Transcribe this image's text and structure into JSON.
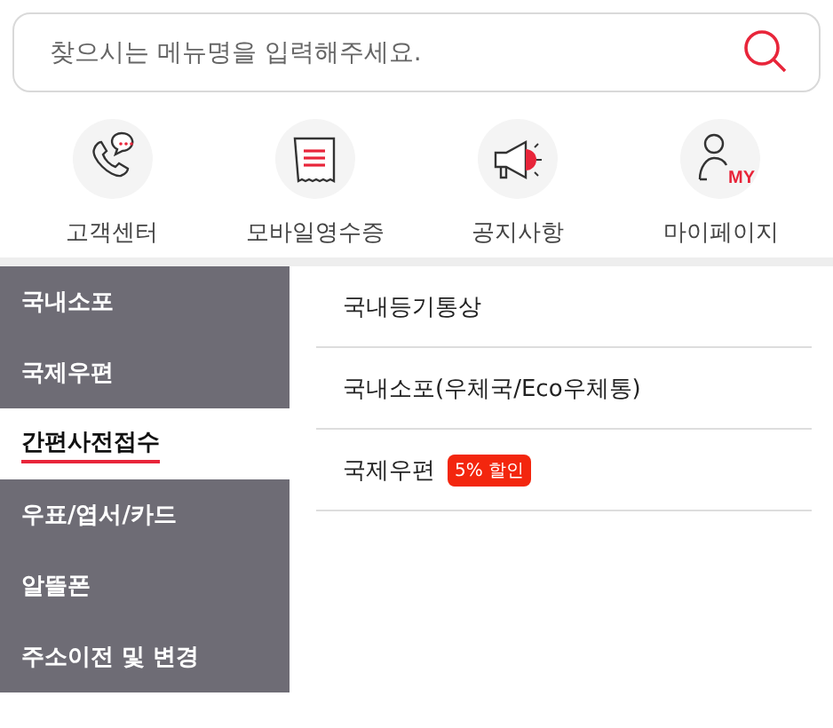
{
  "search": {
    "placeholder": "찾으시는 메뉴명을 입력해주세요."
  },
  "shortcuts": [
    {
      "label": "고객센터",
      "kind": "phone"
    },
    {
      "label": "모바일영수증",
      "kind": "receipt"
    },
    {
      "label": "공지사항",
      "kind": "megaphone"
    },
    {
      "label": "마이페이지",
      "kind": "person",
      "icon_text": "MY"
    }
  ],
  "sidebar": {
    "items": [
      {
        "label": "국내소포",
        "selected": false
      },
      {
        "label": "국제우편",
        "selected": false
      },
      {
        "label": "간편사전접수",
        "selected": true
      },
      {
        "label": "우표/엽서/카드",
        "selected": false
      },
      {
        "label": "알뜰폰",
        "selected": false
      },
      {
        "label": "주소이전 및 변경",
        "selected": false
      }
    ]
  },
  "submenu": [
    {
      "label": "국내등기통상"
    },
    {
      "label": "국내소포(우체국/Eco우체통)"
    },
    {
      "label": "국제우편",
      "badge": "5% 할인"
    }
  ]
}
